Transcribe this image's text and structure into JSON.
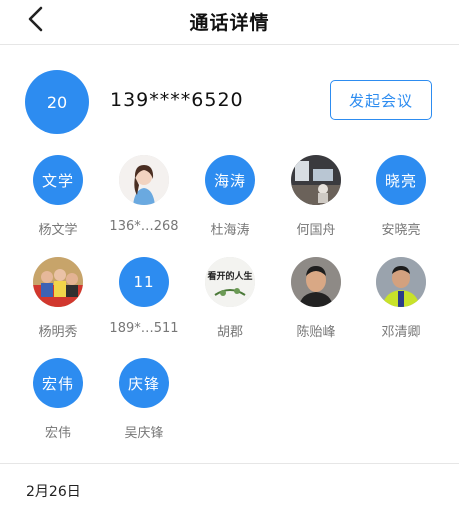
{
  "header": {
    "title": "通话详情"
  },
  "caller": {
    "avatar_text": "20",
    "number": "139****6520",
    "meeting_button": "发起会议"
  },
  "participants": [
    {
      "name": "杨文学",
      "avatar_text": "文学",
      "type": "text"
    },
    {
      "name": "136*…268",
      "avatar_text": "",
      "type": "photo",
      "photo": "woman-portrait"
    },
    {
      "name": "杜海涛",
      "avatar_text": "海涛",
      "type": "text"
    },
    {
      "name": "何国舟",
      "avatar_text": "",
      "type": "photo",
      "photo": "room-scene"
    },
    {
      "name": "安晓亮",
      "avatar_text": "晓亮",
      "type": "text"
    },
    {
      "name": "杨明秀",
      "avatar_text": "",
      "type": "photo",
      "photo": "group-photo"
    },
    {
      "name": "189*…511",
      "avatar_text": "11",
      "type": "text"
    },
    {
      "name": "胡郡",
      "avatar_text": "看开的人生",
      "type": "photo",
      "photo": "calligraphy"
    },
    {
      "name": "陈贻峰",
      "avatar_text": "",
      "type": "photo",
      "photo": "man-portrait"
    },
    {
      "name": "邓清卿",
      "avatar_text": "",
      "type": "photo",
      "photo": "worker-vest"
    },
    {
      "name": "宏伟",
      "avatar_text": "宏伟",
      "type": "text"
    },
    {
      "name": "吴庆锋",
      "avatar_text": "庆锋",
      "type": "text"
    }
  ],
  "date": "2月26日",
  "colors": {
    "accent": "#2d8cf0"
  }
}
